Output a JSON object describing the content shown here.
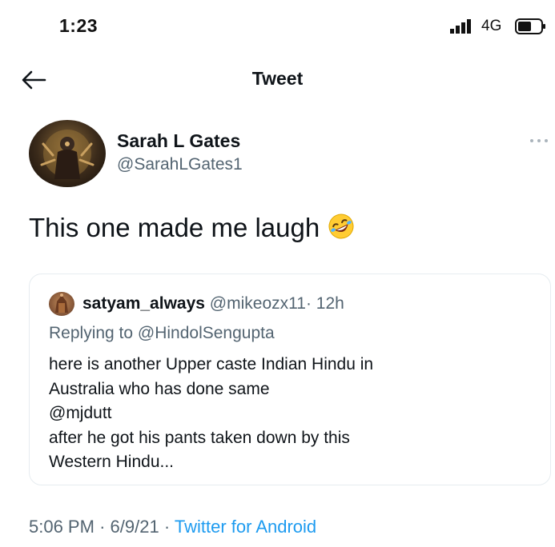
{
  "status_bar": {
    "time": "1:23",
    "network": "4G",
    "icons": [
      "signal-icon",
      "battery-icon"
    ]
  },
  "header": {
    "title": "Tweet",
    "back_icon": "back-arrow-icon"
  },
  "tweet": {
    "author_name": "Sarah L Gates",
    "author_handle": "@SarahLGates1",
    "text": "This one made me laugh",
    "emoji_icon": "rolling-on-floor-laughing-emoji-icon",
    "more_icon": "more-options-icon",
    "quoted": {
      "name": "satyam_always",
      "handle": "@mikeozx11",
      "separator": "·",
      "time": "12h",
      "replying_to": "Replying to @HindolSengupta",
      "lines": [
        "here is another Upper caste Indian Hindu in",
        "Australia who has done same",
        "@mjdutt",
        "after he got his pants taken down by this",
        "Western Hindu..."
      ]
    },
    "meta": {
      "time": "5:06 PM",
      "separator": "·",
      "date": "6/9/21",
      "source": "Twitter for Android"
    }
  },
  "colors": {
    "text": "#0f1419",
    "secondary": "#536471",
    "link": "#1d9bf0",
    "border": "#e6ecf0"
  }
}
